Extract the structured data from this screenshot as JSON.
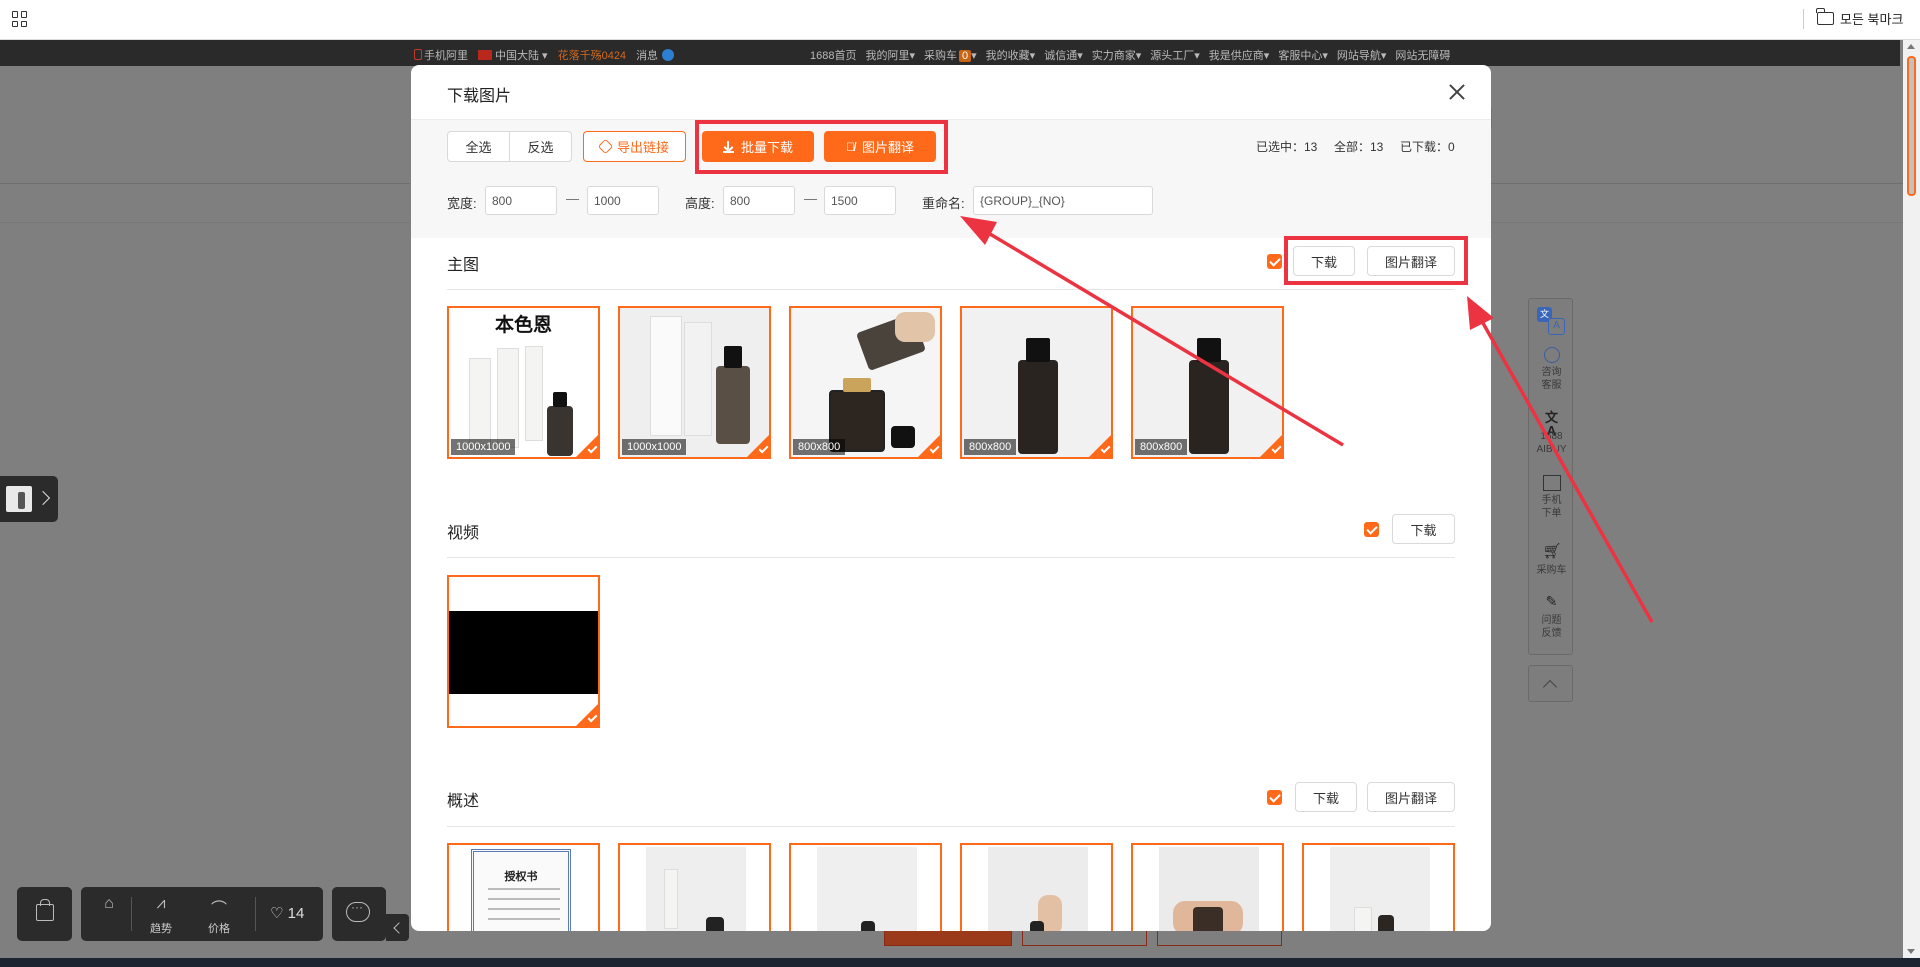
{
  "browser": {
    "bookmarks_folder": "모든 북마크"
  },
  "site_nav": {
    "left": [
      "手机阿里",
      "中国大陆",
      "花落千殇0424",
      "消息"
    ],
    "right": [
      "1688首页",
      "我的阿里",
      "采购车",
      "0",
      "我的收藏",
      "诚信通",
      "实力商家",
      "源头工厂",
      "我是供应商",
      "客服中心",
      "网站导航",
      "网站无障碍"
    ]
  },
  "modal": {
    "title": "下载图片",
    "select_all": "全选",
    "invert": "反选",
    "export_links": "导出链接",
    "batch_download": "批量下载",
    "image_translate": "图片翻译",
    "selected_count": "已选中：13",
    "total_count": "全部：13",
    "downloaded_count": "已下载：0",
    "filters": {
      "width_label": "宽度:",
      "width_min": "800",
      "width_max": "1000",
      "height_label": "高度:",
      "height_min": "800",
      "height_max": "1500",
      "rename_label": "重命名:",
      "rename_value": "{GROUP}_{NO}",
      "dash": "—"
    },
    "sections": {
      "main": {
        "title": "主图",
        "download": "下载",
        "translate": "图片翻译",
        "images": [
          {
            "size": "1000x1000",
            "caption": "本色恩"
          },
          {
            "size": "1000x1000"
          },
          {
            "size": "800x800"
          },
          {
            "size": "800x800"
          },
          {
            "size": "800x800"
          }
        ]
      },
      "video": {
        "title": "视频",
        "download": "下载"
      },
      "overview": {
        "title": "概述",
        "download": "下载",
        "translate": "图片翻译",
        "cert_title": "授权书"
      }
    }
  },
  "right_tools": [
    "咨询客服",
    "1688 AIBUY",
    "手机下单",
    "采购车",
    "问题反馈"
  ],
  "bottom_bar": {
    "trend": "趋势",
    "price": "价格",
    "favorites": "14"
  },
  "colors": {
    "accent": "#ff6a1a",
    "annotation": "#ec3341"
  }
}
